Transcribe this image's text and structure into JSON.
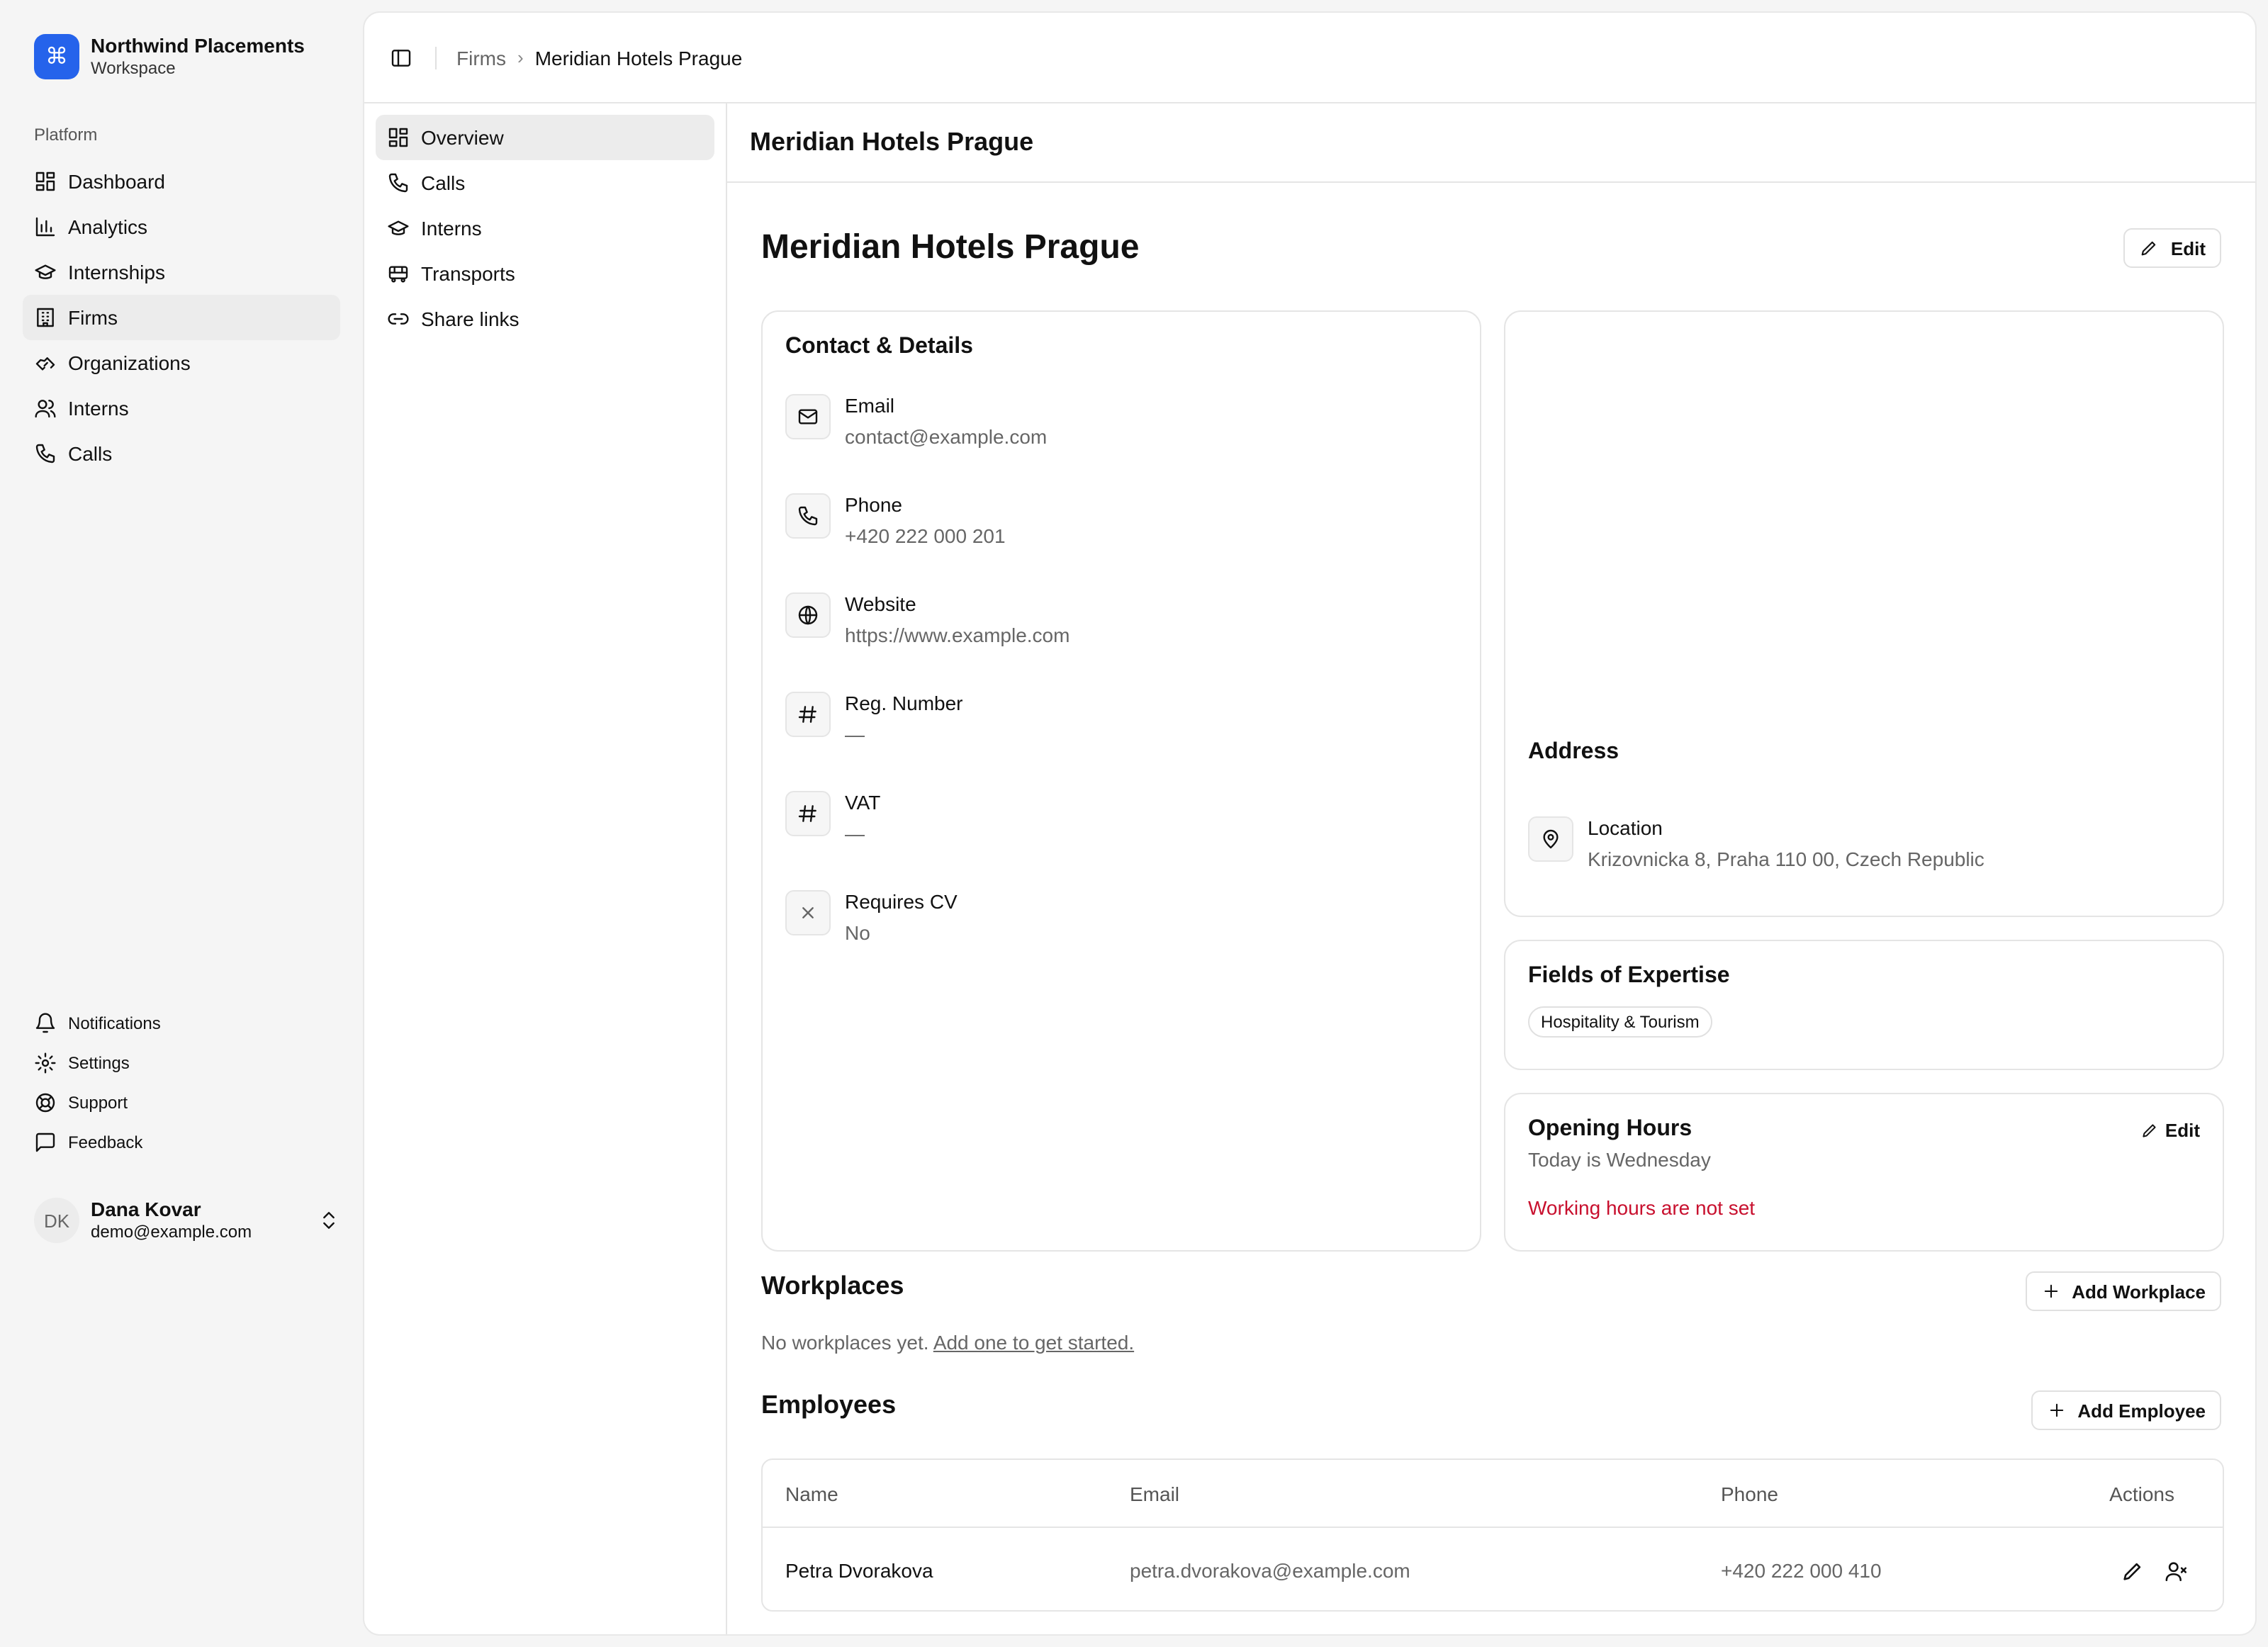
{
  "brand": {
    "title": "Northwind Placements",
    "subtitle": "Workspace",
    "logo_glyph": "⌘",
    "color": "#2563eb"
  },
  "sidebar": {
    "group_label": "Platform",
    "items": [
      {
        "label": "Dashboard",
        "icon": "dashboard-icon"
      },
      {
        "label": "Analytics",
        "icon": "bar-chart-icon"
      },
      {
        "label": "Internships",
        "icon": "graduation-cap-icon"
      },
      {
        "label": "Firms",
        "icon": "building-icon",
        "active": true
      },
      {
        "label": "Organizations",
        "icon": "handshake-icon"
      },
      {
        "label": "Interns",
        "icon": "users-icon"
      },
      {
        "label": "Calls",
        "icon": "phone-icon"
      }
    ],
    "secondary": [
      {
        "label": "Notifications",
        "icon": "bell-icon"
      },
      {
        "label": "Settings",
        "icon": "gear-icon"
      },
      {
        "label": "Support",
        "icon": "lifebuoy-icon"
      },
      {
        "label": "Feedback",
        "icon": "message-square-icon"
      }
    ],
    "user": {
      "initials": "DK",
      "name": "Dana Kovar",
      "email": "demo@example.com"
    }
  },
  "breadcrumb": {
    "parent": "Firms",
    "current": "Meridian Hotels Prague"
  },
  "subnav": [
    {
      "label": "Overview",
      "icon": "layout-dashboard-icon",
      "active": true
    },
    {
      "label": "Calls",
      "icon": "phone-icon"
    },
    {
      "label": "Interns",
      "icon": "graduation-cap-icon"
    },
    {
      "label": "Transports",
      "icon": "bus-icon"
    },
    {
      "label": "Share links",
      "icon": "link-icon"
    }
  ],
  "content": {
    "header": "Meridian Hotels Prague",
    "title": "Meridian Hotels Prague",
    "edit_label": "Edit"
  },
  "contact": {
    "title": "Contact & Details",
    "items": [
      {
        "label": "Email",
        "value": "contact@example.com",
        "icon": "mail-icon"
      },
      {
        "label": "Phone",
        "value": "+420 222 000 201",
        "icon": "phone-icon"
      },
      {
        "label": "Website",
        "value": "https://www.example.com",
        "icon": "globe-icon"
      },
      {
        "label": "Reg. Number",
        "value": "—",
        "icon": "hash-icon"
      },
      {
        "label": "VAT",
        "value": "—",
        "icon": "hash-icon"
      },
      {
        "label": "Requires CV",
        "value": "No",
        "icon": "x-icon"
      }
    ]
  },
  "address": {
    "title": "Address",
    "label": "Location",
    "value": "Krizovnicka 8, Praha 110 00, Czech Republic"
  },
  "expertise": {
    "title": "Fields of Expertise",
    "tags": [
      "Hospitality & Tourism"
    ]
  },
  "hours": {
    "title": "Opening Hours",
    "subtitle": "Today is Wednesday",
    "warning": "Working hours are not set",
    "edit_label": "Edit",
    "warning_color": "#c8102e"
  },
  "workplaces": {
    "title": "Workplaces",
    "add_label": "Add Workplace",
    "empty_text": "No workplaces yet.",
    "empty_link": "Add one to get started."
  },
  "employees": {
    "title": "Employees",
    "add_label": "Add Employee",
    "columns": [
      "Name",
      "Email",
      "Phone",
      "Actions"
    ],
    "rows": [
      {
        "name": "Petra Dvorakova",
        "email": "petra.dvorakova@example.com",
        "phone": "+420 222 000 410"
      }
    ]
  }
}
